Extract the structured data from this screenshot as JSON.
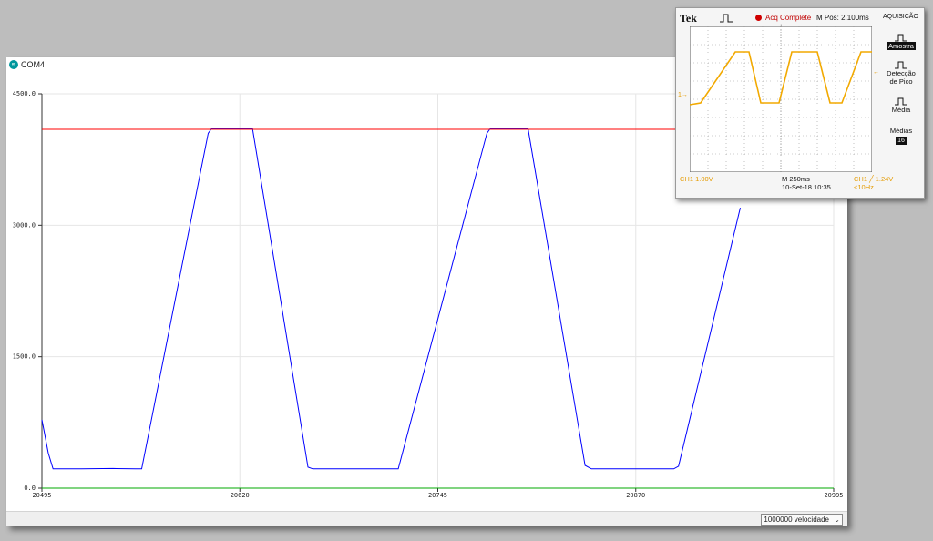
{
  "window": {
    "title": "COM4"
  },
  "status_bar": {
    "baud_rate": "1000000 velocidade"
  },
  "chart_data": {
    "type": "line",
    "x_ticks": [
      "20495",
      "20620",
      "20745",
      "20870",
      "20995"
    ],
    "y_ticks": [
      "4500.0",
      "3000.0",
      "1500.0",
      "0.0"
    ],
    "xlim": [
      20495,
      20995
    ],
    "ylim": [
      0,
      4500
    ],
    "grid": true,
    "series": [
      {
        "color": "#0000ff",
        "x": [
          20495,
          20499,
          20502,
          20520,
          20540,
          20554,
          20558,
          20600,
          20602,
          20622,
          20628,
          20663,
          20666,
          20680,
          20700,
          20716,
          20720,
          20776,
          20778,
          20797,
          20802,
          20838,
          20842,
          20860,
          20890,
          20894,
          20897,
          20936
        ],
        "y": [
          780,
          400,
          220,
          220,
          225,
          220,
          220,
          4050,
          4100,
          4100,
          4100,
          240,
          220,
          220,
          220,
          220,
          220,
          4050,
          4100,
          4100,
          4100,
          260,
          220,
          220,
          220,
          220,
          250,
          3200
        ]
      },
      {
        "color": "#ff0000",
        "x": [
          20495,
          20995
        ],
        "y": [
          4095,
          4095
        ]
      },
      {
        "color": "#00aa00",
        "x": [
          20495,
          20995
        ],
        "y": [
          0,
          0
        ]
      }
    ]
  },
  "scope": {
    "brand": "Tek",
    "status": "Acq Complete",
    "m_pos": "M Pos: 2.100ms",
    "menu_title": "AQUISIÇÃO",
    "trigger_marker": "↓",
    "ch1_marker": "1→",
    "trig_level_marker": "←",
    "menu": [
      {
        "label": "Amostra",
        "selected": true
      },
      {
        "label": "Detecção de Pico",
        "selected": false
      },
      {
        "label": "Média",
        "selected": false
      },
      {
        "label": "Médias",
        "selected": false,
        "value": "16"
      }
    ],
    "bottom": {
      "ch1_scale": "CH1  1.00V",
      "timebase": "M 250ms",
      "date": "10-Set-18 10:35",
      "trigger": "CH1  ╱  1.24V",
      "freq": "<10Hz"
    },
    "waveform": {
      "color": "#f2a900",
      "x_ms": [
        0,
        60,
        250,
        325,
        390,
        490,
        560,
        700,
        770,
        835,
        940,
        1000
      ],
      "y_div": [
        -0.1,
        0,
        2.8,
        2.8,
        0,
        0,
        2.8,
        2.8,
        0,
        0,
        2.8,
        2.8
      ]
    }
  }
}
